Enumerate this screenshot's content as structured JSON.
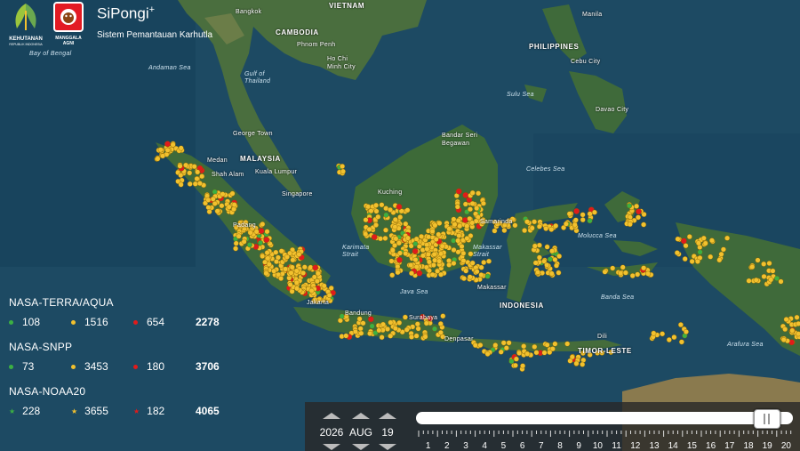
{
  "header": {
    "logo1_line1": "KEHUTANAN",
    "logo1_line2": "REPUBLIK INDONESIA",
    "logo2_text": "MANGGALA AGNI",
    "title": "SiPongi",
    "title_sup": "+",
    "subtitle": "Sistem Pemantauan Karhutla"
  },
  "map_labels": {
    "vietnam": "VIETNAM",
    "bangkok": "Bangkok",
    "cambodia": "CAMBODIA",
    "phnom_penh": "Phnom Penh",
    "ho_chi_minh": "Ho Chi Minh City",
    "philippines": "PHILIPPINES",
    "manila": "Manila",
    "cebu": "Cebu City",
    "davao": "Davao City",
    "bay_of_bengal": "Bay of Bengal",
    "andaman": "Andaman Sea",
    "gulf_thailand": "Gulf of Thailand",
    "sulu": "Sulu Sea",
    "malaysia": "MALAYSIA",
    "george_town": "George Town",
    "medan": "Medan",
    "shah_alam": "Shah Alam",
    "kuala_lumpur": "Kuala Lumpur",
    "singapore": "Singapore",
    "bandar": "Bandar Seri Begawan",
    "kuching": "Kuching",
    "celebes": "Celebes Sea",
    "samarinda": "Samarinda",
    "molucca": "Molucca Sea",
    "padang": "Padang",
    "karimata": "Karimata Strait",
    "makassar_strait": "Makassar Strait",
    "java_sea": "Java Sea",
    "makassar": "Makassar",
    "indonesia": "INDONESIA",
    "banda": "Banda Sea",
    "jakarta": "Jakarta",
    "bandung": "Bandung",
    "surabaya": "Surabaya",
    "denpasar": "Denpasar",
    "dili": "Dili",
    "timor_leste": "TIMOR-LESTE",
    "arafura": "Arafura Sea"
  },
  "stats": [
    {
      "source": "NASA-TERRA/AQUA",
      "marker": "dot",
      "low": "108",
      "medium": "1516",
      "high": "654",
      "total": "2278"
    },
    {
      "source": "NASA-SNPP",
      "marker": "dot",
      "low": "73",
      "medium": "3453",
      "high": "180",
      "total": "3706"
    },
    {
      "source": "NASA-NOAA20",
      "marker": "star",
      "low": "228",
      "medium": "3655",
      "high": "182",
      "total": "4065"
    }
  ],
  "colors": {
    "low": "#3cb043",
    "medium": "#f2c12e",
    "high": "#e01b1b",
    "ocean": "#1d4a63",
    "land": "#3f6a3a",
    "timebar": "#2c2c2c"
  },
  "time": {
    "year": "2026",
    "month": "AUG",
    "day": "19",
    "slider_value": 0.93,
    "tick_labels": [
      "1",
      "2",
      "3",
      "4",
      "5",
      "6",
      "7",
      "8",
      "9",
      "10",
      "11",
      "12",
      "13",
      "14",
      "15",
      "16",
      "17",
      "18",
      "19",
      "20"
    ]
  }
}
